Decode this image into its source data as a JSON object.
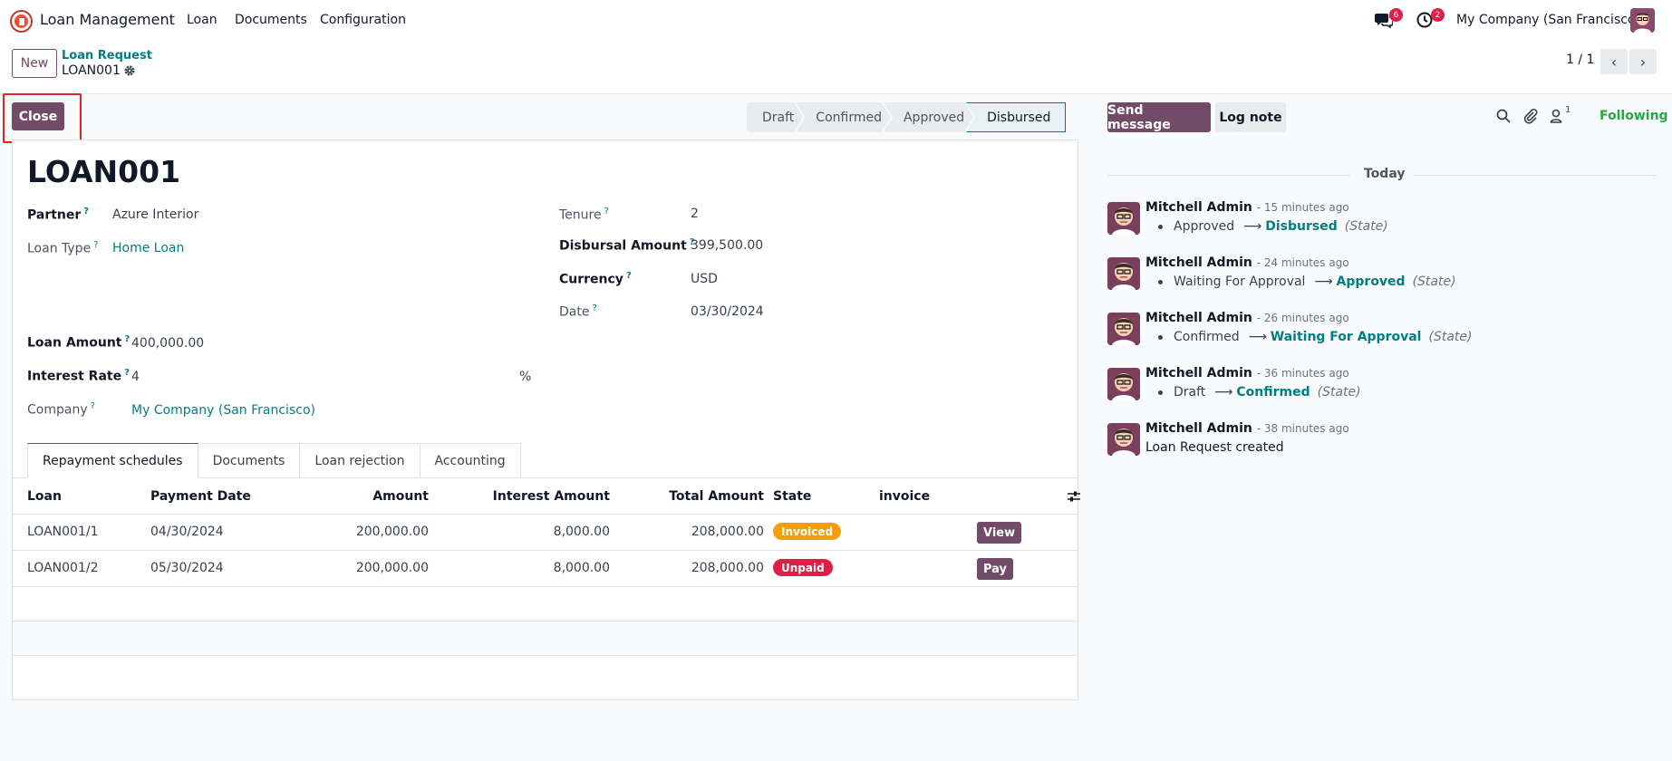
{
  "topnav": {
    "app_name": "Loan Management",
    "menu": [
      "Loan",
      "Documents",
      "Configuration"
    ],
    "messages_badge": "6",
    "activities_badge": "2",
    "company": "My Company (San Francisco)"
  },
  "control": {
    "new_label": "New",
    "breadcrumb": "Loan Request",
    "record": "LOAN001",
    "pager": "1 / 1"
  },
  "actions": {
    "close_label": "Close"
  },
  "status": {
    "stages": [
      "Draft",
      "Confirmed",
      "Approved",
      "Disbursed"
    ],
    "active": "Disbursed"
  },
  "form": {
    "title": "LOAN001",
    "fields": {
      "partner": {
        "label": "Partner",
        "value": "Azure Interior"
      },
      "loan_type": {
        "label": "Loan Type",
        "value": "Home Loan"
      },
      "tenure": {
        "label": "Tenure",
        "value": "2"
      },
      "disbursal_amount": {
        "label": "Disbursal Amount",
        "value": "399,500.00"
      },
      "currency": {
        "label": "Currency",
        "value": "USD"
      },
      "date": {
        "label": "Date",
        "value": "03/30/2024"
      },
      "loan_amount": {
        "label": "Loan Amount",
        "value": "400,000.00"
      },
      "interest_rate": {
        "label": "Interest Rate",
        "value": "4",
        "unit": "%"
      },
      "company": {
        "label": "Company",
        "value": "My Company (San Francisco)"
      }
    },
    "help_marker": "?"
  },
  "tabs": [
    "Repayment schedules",
    "Documents",
    "Loan rejection",
    "Accounting"
  ],
  "table": {
    "headers": {
      "loan": "Loan",
      "payment_date": "Payment Date",
      "amount": "Amount",
      "interest": "Interest Amount",
      "total": "Total Amount",
      "state": "State",
      "invoice": "invoice"
    },
    "rows": [
      {
        "loan": "LOAN001/1",
        "date": "04/30/2024",
        "amount": "200,000.00",
        "interest": "8,000.00",
        "total": "208,000.00",
        "state": "Invoiced",
        "state_color": "#f59e0b",
        "action": "View"
      },
      {
        "loan": "LOAN001/2",
        "date": "05/30/2024",
        "amount": "200,000.00",
        "interest": "8,000.00",
        "total": "208,000.00",
        "state": "Unpaid",
        "state_color": "#e11d48",
        "action": "Pay"
      }
    ]
  },
  "chatter": {
    "send_label": "Send message",
    "log_label": "Log note",
    "followers_count": "1",
    "following_label": "Following",
    "day_label": "Today",
    "messages": [
      {
        "author": "Mitchell Admin",
        "time": "- 15 minutes ago",
        "old": "Approved",
        "new": "Disbursed",
        "field": "(State)"
      },
      {
        "author": "Mitchell Admin",
        "time": "- 24 minutes ago",
        "old": "Waiting For Approval",
        "new": "Approved",
        "field": "(State)"
      },
      {
        "author": "Mitchell Admin",
        "time": "- 26 minutes ago",
        "old": "Confirmed",
        "new": "Waiting For Approval",
        "field": "(State)"
      },
      {
        "author": "Mitchell Admin",
        "time": "- 36 minutes ago",
        "old": "Draft",
        "new": "Confirmed",
        "field": "(State)"
      },
      {
        "author": "Mitchell Admin",
        "time": "- 38 minutes ago",
        "text": "Loan Request created"
      }
    ]
  }
}
